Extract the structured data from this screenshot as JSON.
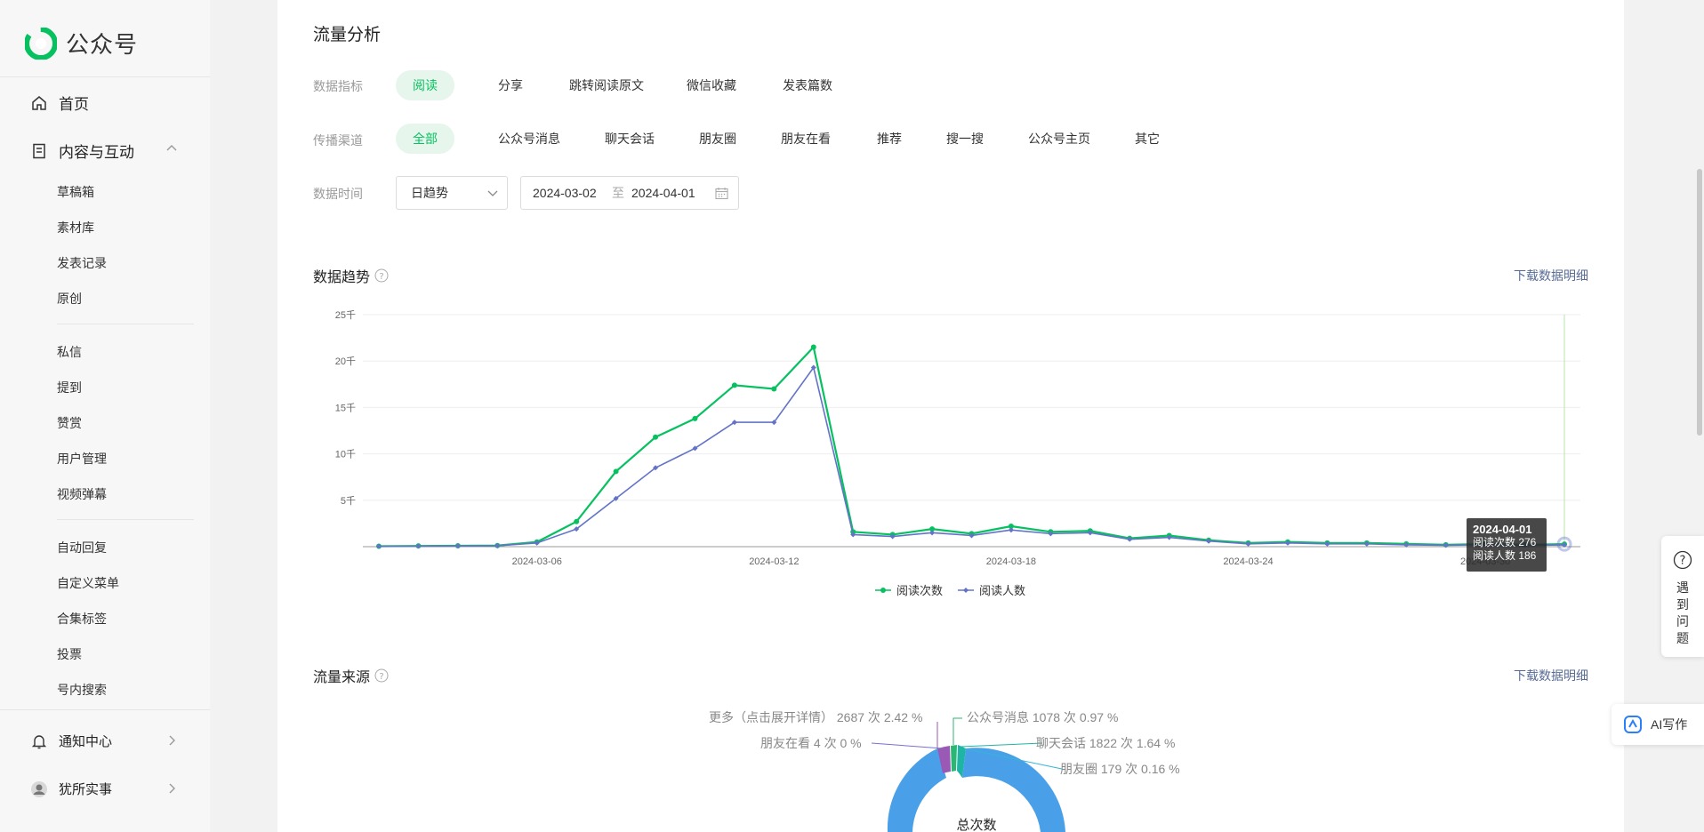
{
  "brand": {
    "name": "公众号"
  },
  "sidebar": {
    "home": "首页",
    "content_group": "内容与互动",
    "content_items": [
      "草稿箱",
      "素材库",
      "发表记录",
      "原创"
    ],
    "interact_items": [
      "私信",
      "提到",
      "赞赏",
      "用户管理",
      "视频弹幕"
    ],
    "tool_items": [
      "自动回复",
      "自定义菜单",
      "合集标签",
      "投票",
      "号内搜索"
    ],
    "notify": "通知中心",
    "account": "犹所实事"
  },
  "traffic": {
    "title": "流量分析",
    "metric_label": "数据指标",
    "metrics": [
      "阅读",
      "分享",
      "跳转阅读原文",
      "微信收藏",
      "发表篇数"
    ],
    "active_metric": 0,
    "channel_label": "传播渠道",
    "channels": [
      "全部",
      "公众号消息",
      "聊天会话",
      "朋友圈",
      "朋友在看",
      "推荐",
      "搜一搜",
      "公众号主页",
      "其它"
    ],
    "active_channel": 0,
    "time_label": "数据时间",
    "granularity": "日趋势",
    "date_start": "2024-03-02",
    "date_sep": "至",
    "date_end": "2024-04-01"
  },
  "trend": {
    "title": "数据趋势",
    "download": "下载数据明细",
    "tooltip": {
      "date": "2024-04-01",
      "line1": "阅读次数 276",
      "line2": "阅读人数 186"
    }
  },
  "chart_data": {
    "type": "line",
    "x": [
      "2024-03-02",
      "2024-03-03",
      "2024-03-04",
      "2024-03-05",
      "2024-03-06",
      "2024-03-07",
      "2024-03-08",
      "2024-03-09",
      "2024-03-10",
      "2024-03-11",
      "2024-03-12",
      "2024-03-13",
      "2024-03-14",
      "2024-03-15",
      "2024-03-16",
      "2024-03-17",
      "2024-03-18",
      "2024-03-19",
      "2024-03-20",
      "2024-03-21",
      "2024-03-22",
      "2024-03-23",
      "2024-03-24",
      "2024-03-25",
      "2024-03-26",
      "2024-03-27",
      "2024-03-28",
      "2024-03-29",
      "2024-03-30",
      "2024-03-31",
      "2024-04-01"
    ],
    "x_tick_labels": [
      "2024-03-06",
      "2024-03-12",
      "2024-03-18",
      "2024-03-24",
      "2024-03-30"
    ],
    "y_tick_labels": [
      "5千",
      "10千",
      "15千",
      "20千",
      "25千"
    ],
    "ylim": [
      0,
      25000
    ],
    "series": [
      {
        "name": "阅读次数",
        "color": "#07c160",
        "values": [
          50,
          80,
          100,
          120,
          500,
          2700,
          8100,
          11800,
          13800,
          17400,
          17000,
          21500,
          1600,
          1300,
          1900,
          1400,
          2200,
          1600,
          1700,
          900,
          1200,
          700,
          400,
          500,
          400,
          400,
          300,
          200,
          300,
          200,
          276
        ]
      },
      {
        "name": "阅读人数",
        "color": "#6373c8",
        "values": [
          40,
          60,
          80,
          100,
          400,
          1900,
          5200,
          8500,
          10600,
          13400,
          13400,
          19300,
          1300,
          1100,
          1500,
          1200,
          1800,
          1400,
          1500,
          800,
          1000,
          600,
          300,
          400,
          300,
          300,
          200,
          150,
          200,
          150,
          186
        ]
      }
    ],
    "grid": true,
    "legend": "bottom-center"
  },
  "source": {
    "title": "流量来源",
    "download": "下载数据明细",
    "center_label": "总次数",
    "slices": [
      {
        "label": "更多（点击展开详情） 2687 次 2.42 %",
        "color": "#9b59b6"
      },
      {
        "label": "朋友在看 4 次 0 %",
        "color": "#7a6fd0"
      },
      {
        "label": "公众号消息 1078 次 0.97 %",
        "color": "#2bb673"
      },
      {
        "label": "聊天会话 1822 次 1.64 %",
        "color": "#1fb5a4"
      },
      {
        "label": "朋友圈 179 次 0.16 %",
        "color": "#33b6d6"
      }
    ]
  },
  "floating": {
    "help": "遇到问题",
    "ai": "AI写作"
  }
}
